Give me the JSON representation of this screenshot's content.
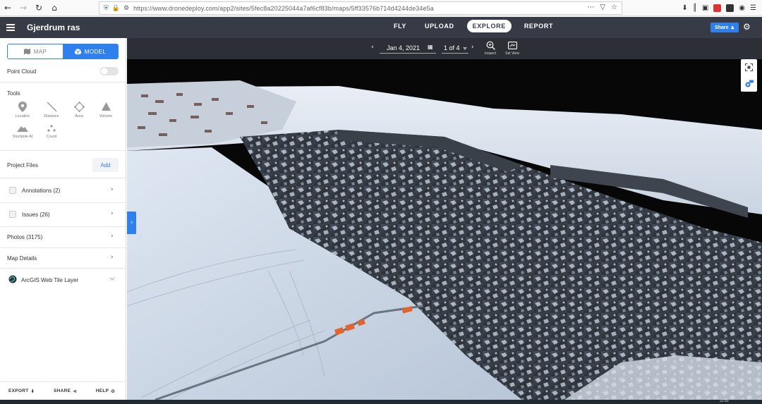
{
  "browser": {
    "url": "https://www.dronedeploy.com/app2/sites/5fec8a20225044a7af6cf83b/maps/5ff33576b714d4244de34e5a",
    "nav_icons": [
      "back-icon",
      "forward-icon",
      "reload-icon",
      "home-icon"
    ],
    "toolbar_icons": [
      "download-icon",
      "library-icon",
      "reader-icon",
      "extension-icon",
      "menu-icon"
    ]
  },
  "header": {
    "title": "Gjerdrum ras",
    "tabs": [
      {
        "label": "FLY",
        "active": false
      },
      {
        "label": "UPLOAD",
        "active": false
      },
      {
        "label": "EXPLORE",
        "active": true
      },
      {
        "label": "REPORT",
        "active": false
      }
    ],
    "share_label": "Share",
    "accent": "#2f80ed",
    "header_bg": "#363b45"
  },
  "sidebar": {
    "view_toggle": {
      "map_label": "MAP",
      "model_label": "MODEL",
      "selected": "MODEL"
    },
    "point_cloud_label": "Point Cloud",
    "point_cloud_enabled": false,
    "tools_heading": "Tools",
    "tools": [
      {
        "label": "Location",
        "icon": "location-pin-icon"
      },
      {
        "label": "Distance",
        "icon": "distance-line-icon"
      },
      {
        "label": "Area",
        "icon": "area-polygon-icon"
      },
      {
        "label": "Volume",
        "icon": "volume-cone-icon"
      },
      {
        "label": "Stockpile AI",
        "icon": "stockpile-icon"
      },
      {
        "label": "Count",
        "icon": "count-dots-icon"
      }
    ],
    "project_files_label": "Project Files",
    "add_label": "Add",
    "annotations_label": "Annotations (2)",
    "issues_label": "Issues (26)",
    "photos_label": "Photos (3175)",
    "map_details_label": "Map Details",
    "arcgis_label": "ArcGIS Web Tile Layer",
    "footer": {
      "export_label": "EXPORT",
      "share_label": "SHARE",
      "help_label": "HELP"
    }
  },
  "viewer": {
    "date": "Jan 4, 2021",
    "page": "1 of 4",
    "inspect_label": "Inspect",
    "set_view_label": "Set View"
  },
  "taskbar": {
    "clock": "22:50"
  }
}
